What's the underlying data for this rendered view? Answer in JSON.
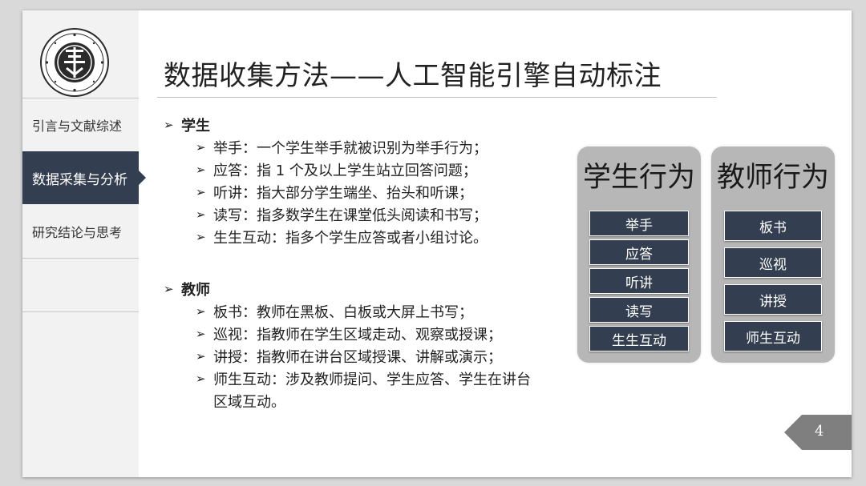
{
  "nav": {
    "items": [
      {
        "label": "引言与文献综述",
        "active": false
      },
      {
        "label": "数据采集与分析",
        "active": true
      },
      {
        "label": "研究结论与思考",
        "active": false
      }
    ]
  },
  "slide": {
    "title": "数据收集方法——人工智能引擎自动标注",
    "page_number": "4"
  },
  "content": {
    "bullet_glyph": "➢",
    "students": {
      "heading": "学生",
      "items": [
        "举手：一个学生举手就被识别为举手行为；",
        "应答：指 1 个及以上学生站立回答问题；",
        "听讲：指大部分学生端坐、抬头和听课；",
        "读写：指多数学生在课堂低头阅读和书写；",
        "生生互动：指多个学生应答或者小组讨论。"
      ]
    },
    "teachers": {
      "heading": "教师",
      "items": [
        "板书：教师在黑板、白板或大屏上书写；",
        "巡视：指教师在学生区域走动、观察或授课；",
        "讲授：指教师在讲台区域授课、讲解或演示；",
        "师生互动：涉及教师提问、学生应答、学生在讲台"
      ],
      "continuation": "区域互动。"
    }
  },
  "panels": {
    "student": {
      "title": "学生行为",
      "chips": [
        "举手",
        "应答",
        "听讲",
        "读写",
        "生生互动"
      ]
    },
    "teacher": {
      "title": "教师行为",
      "chips": [
        "板书",
        "巡视",
        "讲授",
        "师生互动"
      ]
    }
  },
  "colors": {
    "nav_active": "#333f50",
    "chip": "#333f50",
    "panel": "#b7b7b7",
    "page_tag": "#7f7f7f"
  }
}
